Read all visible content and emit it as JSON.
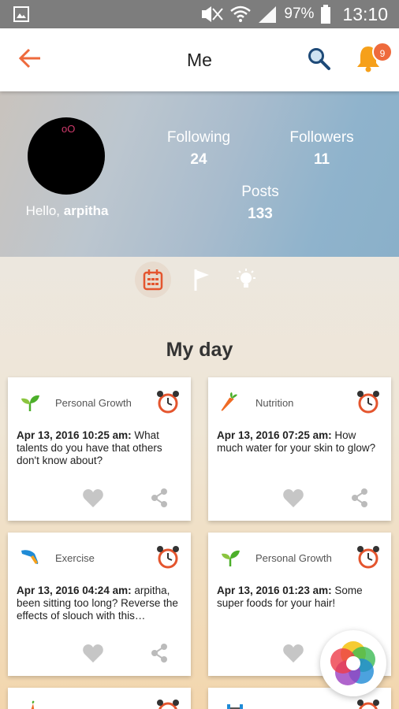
{
  "status_bar": {
    "battery": "97%",
    "time": "13:10"
  },
  "app_bar": {
    "title": "Me",
    "notification_count": "9"
  },
  "profile": {
    "greeting_prefix": "Hello, ",
    "username": "arpitha",
    "avatar_mark": "oO",
    "following_label": "Following",
    "following_count": "24",
    "followers_label": "Followers",
    "followers_count": "11",
    "posts_label": "Posts",
    "posts_count": "133"
  },
  "tabs": [
    {
      "icon": "calendar-icon",
      "active": true
    },
    {
      "icon": "flag-icon",
      "active": false
    },
    {
      "icon": "lightbulb-icon",
      "active": false
    }
  ],
  "section_title": "My day",
  "cards": [
    {
      "category": "Personal Growth",
      "category_icon": "sprout-icon",
      "timestamp": "Apr 13, 2016 10:25 am:",
      "text": " What talents do you have that others don't know about?"
    },
    {
      "category": "Nutrition",
      "category_icon": "carrot-icon",
      "timestamp": "Apr 13, 2016 07:25 am:",
      "text": " How much water for your skin to glow?"
    },
    {
      "category": "Exercise",
      "category_icon": "running-shoe-icon",
      "timestamp": "Apr 13, 2016 04:24 am:",
      "text": " arpitha, been sitting too long? Reverse the effects of slouch with this…"
    },
    {
      "category": "Personal Growth",
      "category_icon": "sprout-icon",
      "timestamp": "Apr 13, 2016 01:23 am:",
      "text": " Some super foods for your hair!"
    }
  ],
  "colors": {
    "accent": "#ee6a3c",
    "status_bar": "#7d7d7d"
  }
}
